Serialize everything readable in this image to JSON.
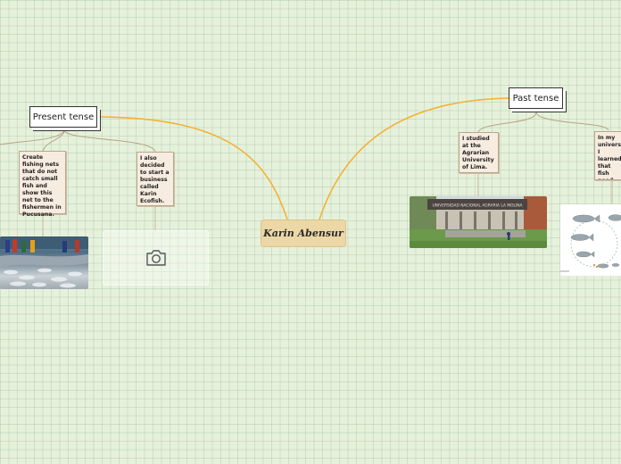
{
  "central_topic": {
    "label": "Karin Abensur"
  },
  "branches": [
    {
      "label": "Present tense",
      "notes": [
        "Create fishing nets that do not catch small fish and show this net to the fishermen in Pucusana.",
        "I also decided to start a business called Karin Ecofish."
      ]
    },
    {
      "label": "Past tense",
      "notes": [
        "I studied at the Agrarian University of Lima.",
        "In my university I learned that fish need time to grow."
      ]
    }
  ],
  "images": {
    "fishing_photo": "fishermen-catch-photo",
    "placeholder_icon": "camera-icon",
    "university_photo": "university-gate-photo",
    "university_sign": "UNIVERSIDAD NACIONAL AGRARIA LA MOLINA",
    "fish_growth_photo": "fish-growth-cycle-illustration"
  },
  "colors": {
    "main_link": "#f3b233",
    "sub_link": "#b8a37f",
    "central_fill": "#ecd7a6"
  }
}
